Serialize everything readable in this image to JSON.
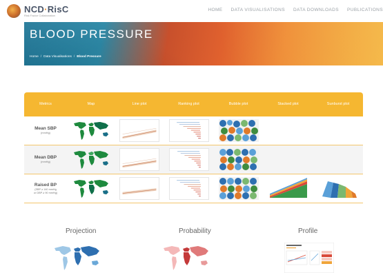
{
  "brand": {
    "name_main": "NCD",
    "name_accent": "RisC",
    "name_separator": "·",
    "tagline": "Risk Factor Collaboration"
  },
  "nav": {
    "items": [
      "HOME",
      "DATA VISUALISATIONS",
      "DATA DOWNLOADS",
      "PUBLICATIONS"
    ]
  },
  "hero": {
    "title": "BLOOD PRESSURE",
    "breadcrumb": {
      "home": "Home",
      "section": "Data Visualisations",
      "current": "Blood Pressure",
      "separator": "/"
    }
  },
  "table": {
    "headers": [
      "Metrics",
      "Map",
      "Line plot",
      "Ranking plot",
      "Bubble plot",
      "Stacked plot",
      "Sunburst plot"
    ],
    "rows": [
      {
        "name": "Mean SBP",
        "sub1": "(mmHg)",
        "sub2": ""
      },
      {
        "name": "Mean DBP",
        "sub1": "(mmHg)",
        "sub2": ""
      },
      {
        "name": "Raised BP",
        "sub1": "(SBP ≥ 140 mmHg",
        "sub2": "or DBP ≥ 90 mmHg)"
      }
    ]
  },
  "cards": [
    {
      "title": "Projection",
      "icon": "blue-world-map"
    },
    {
      "title": "Probability",
      "icon": "red-world-map"
    },
    {
      "title": "Profile",
      "icon": "profile-report-thumbnail"
    }
  ],
  "colors": {
    "accent": "#f5b731",
    "hero_blue": "#1f7ea1",
    "hero_orange": "#e0612e",
    "map_green": "#1e8a3e",
    "map_teal": "#1a6e8a"
  }
}
